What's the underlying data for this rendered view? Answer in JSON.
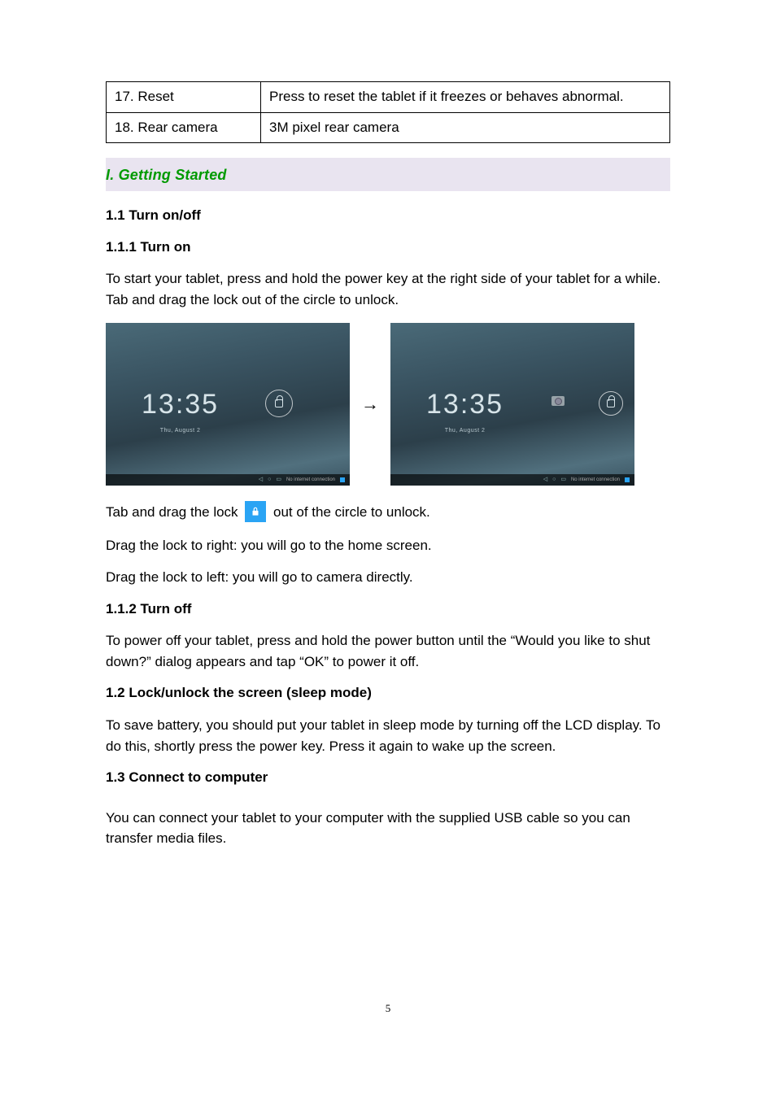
{
  "table": {
    "r1c1": "17.  Reset",
    "r1c2": "Press to reset the tablet if it freezes or behaves abnormal.",
    "r2c1": "18.  Rear camera",
    "r2c2": " 3M pixel rear camera"
  },
  "section_header": "I. Getting Started",
  "h11": "1.1 Turn on/off",
  "h111": "1.1.1 Turn on",
  "p_turnon": "To start your tablet, press and hold the power key at the right side of your tablet for a while. Tab and drag the lock out of the circle to unlock.",
  "screen": {
    "time": "13:35",
    "date": "Thu, August 2",
    "status": "No internet connection"
  },
  "arrow": "→",
  "p_lockline_a": "Tab and drag the lock ",
  "p_lockline_b": " out of the circle to unlock.",
  "p_dragright": "Drag the lock to right: you will go to the home screen.",
  "p_dragleft": "Drag the lock to left: you will go to camera directly.",
  "h112": "1.1.2 Turn off",
  "p_turnoff": "To power off your tablet, press and hold the power button until the “Would you like to shut down?” dialog appears and tap “OK” to power it off.",
  "h12": "1.2 Lock/unlock the screen (sleep mode)",
  "p_lockscreen": "To save battery, you should put your tablet in sleep mode by turning off the LCD display. To do this, shortly press the power key. Press it again to wake up the screen.",
  "h13": "1.3 Connect to computer",
  "p_connect": "You can connect your tablet to your computer with the supplied USB cable so you can transfer media files.",
  "page_number": "5"
}
